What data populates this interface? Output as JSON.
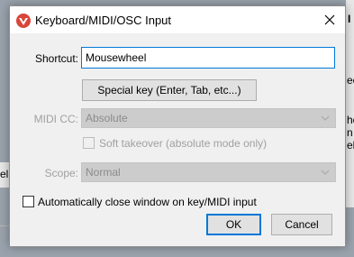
{
  "background": {
    "fragments": [
      "ec",
      "he",
      "n",
      "ela",
      "ele"
    ]
  },
  "dialog": {
    "title": "Keyboard/MIDI/OSC Input",
    "app_icon": "reaper-logo-icon",
    "close_icon": "close-icon",
    "shortcut": {
      "label": "Shortcut:",
      "value": "Mousewheel"
    },
    "special_key_button": "Special key (Enter, Tab, etc...)",
    "midi_cc": {
      "label": "MIDI CC:",
      "value": "Absolute"
    },
    "soft_takeover": {
      "label": "Soft takeover (absolute mode only)",
      "checked": false
    },
    "scope": {
      "label": "Scope:",
      "value": "Normal"
    },
    "auto_close": {
      "label": "Automatically close window on key/MIDI input",
      "checked": false
    },
    "ok_button": "OK",
    "cancel_button": "Cancel"
  },
  "colors": {
    "accent": "#0078d7",
    "icon_red": "#d9453a"
  }
}
